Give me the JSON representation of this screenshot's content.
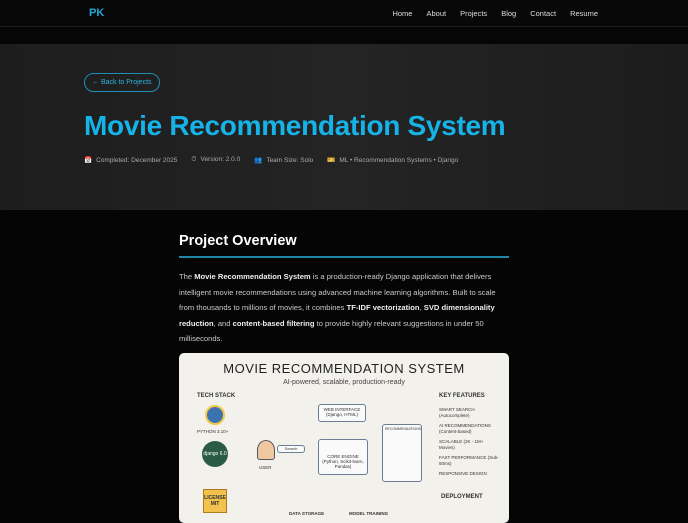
{
  "nav": {
    "logo": "PK",
    "links": [
      "Home",
      "About",
      "Projects",
      "Blog",
      "Contact",
      "Resume"
    ]
  },
  "hero": {
    "back_label": "← Back to Projects",
    "title": "Movie Recommendation System",
    "meta": [
      {
        "icon": "calendar-icon",
        "glyph": "📅",
        "text": "Completed: December 2025"
      },
      {
        "icon": "stopwatch-icon",
        "glyph": "⏱",
        "text": "Version: 2.0.0"
      },
      {
        "icon": "team-icon",
        "glyph": "👥",
        "text": "Team Size: Solo"
      },
      {
        "icon": "ticket-icon",
        "glyph": "🎫",
        "text": "ML • Recommendation Systems • Django"
      }
    ]
  },
  "overview": {
    "heading": "Project Overview",
    "p": [
      "The ",
      "Movie Recommendation System",
      " is a production-ready Django application that delivers intelligent movie recommendations using advanced machine learning algorithms. Built to scale from thousands to millions of movies, it combines ",
      "TF-IDF vectorization",
      ", ",
      "SVD dimensionality reduction",
      ", and ",
      "content-based filtering",
      " to provide highly relevant suggestions in under 50 milliseconds."
    ]
  },
  "infographic": {
    "title": "MOVIE RECOMMENDATION SYSTEM",
    "subtitle": "AI-powered, scalable, production-ready",
    "tech_stack": "TECH STACK",
    "python": "PYTHON 3.10+",
    "django": "django 6.0",
    "license": "LICENSE MIT",
    "web": "WEB INTERFACE (Django, HTML)",
    "user": "USER",
    "search": "Search",
    "core": "CORE ENGINE (Python, Scikit-learn, Pandas)",
    "recs": "RECOMMENDATIONS",
    "data_storage": "DATA STORAGE",
    "model_training": "MODEL TRAINING",
    "key_features": "KEY FEATURES",
    "features": [
      "SMART SEARCH (Autocomplete)",
      "AI RECOMMENDATIONS (Content-based)",
      "SCALABLE (2K - 1M+ Movies)",
      "FAST PERFORMANCE (Sub-50ms)",
      "RESPONSIVE DESIGN"
    ],
    "deployment": "DEPLOYMENT"
  }
}
